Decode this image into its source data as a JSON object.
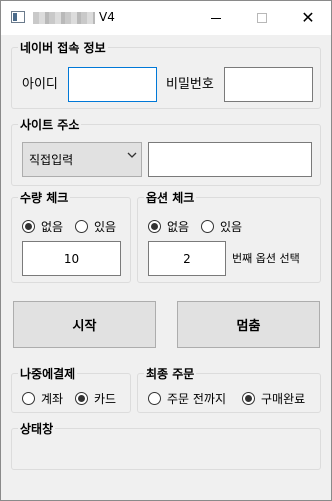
{
  "window": {
    "title": "V4",
    "minimize_icon": "minimize-icon",
    "maximize_icon": "maximize-icon",
    "close_icon": "close-icon"
  },
  "naver_login": {
    "legend": "네이버 접속 정보",
    "id_label": "아이디",
    "id_value": "",
    "password_label": "비밀번호",
    "password_value": ""
  },
  "site_address": {
    "legend": "사이트 주소",
    "selected_option": "직접입력",
    "url_value": ""
  },
  "quantity_check": {
    "legend": "수량 체크",
    "options": [
      "없음",
      "있음"
    ],
    "selected": "없음",
    "value": "10"
  },
  "option_check": {
    "legend": "옵션 체크",
    "options": [
      "없음",
      "있음"
    ],
    "selected": "없음",
    "value": "2",
    "suffix_label": "번째 옵션 선택"
  },
  "actions": {
    "start_label": "시작",
    "stop_label": "멈춤"
  },
  "payment_later": {
    "legend": "나중에결제",
    "options": [
      "계좌",
      "카드"
    ],
    "selected": "카드"
  },
  "final_order": {
    "legend": "최종 주문",
    "options": [
      "주문 전까지",
      "구매완료"
    ],
    "selected": "구매완료"
  },
  "status_window": {
    "legend": "상태창",
    "text": ""
  }
}
